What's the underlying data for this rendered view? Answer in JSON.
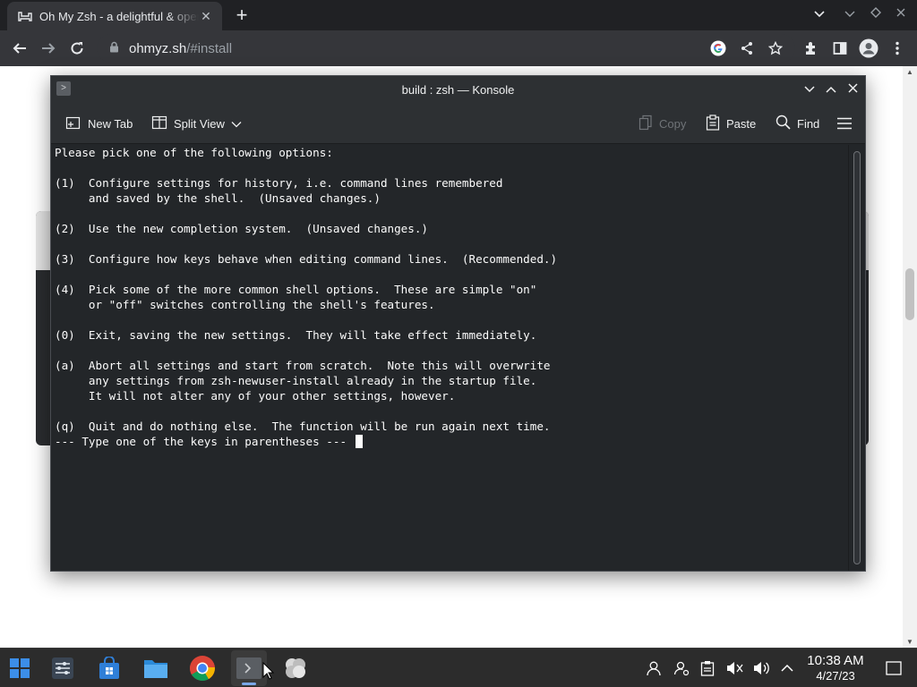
{
  "browser": {
    "tab_title": "Oh My Zsh - a delightful & open source framework for Zsh",
    "url_host": "ohmyz.sh",
    "url_path": "/#install",
    "icons": [
      "tab-favicon",
      "back-icon",
      "forward-icon",
      "reload-icon",
      "lock-icon",
      "google-icon",
      "share-icon",
      "star-icon",
      "extensions-icon",
      "sidepanel-icon",
      "profile-icon",
      "menu-icon"
    ]
  },
  "konsole": {
    "window_title": "build : zsh — Konsole",
    "toolbar": {
      "new_tab": "New Tab",
      "split_view": "Split View",
      "copy": "Copy",
      "paste": "Paste",
      "find": "Find"
    },
    "terminal_lines": [
      "Please pick one of the following options:",
      "",
      "(1)  Configure settings for history, i.e. command lines remembered",
      "     and saved by the shell.  (Unsaved changes.)",
      "",
      "(2)  Use the new completion system.  (Unsaved changes.)",
      "",
      "(3)  Configure how keys behave when editing command lines.  (Recommended.)",
      "",
      "(4)  Pick some of the more common shell options.  These are simple \"on\"",
      "     or \"off\" switches controlling the shell's features.",
      "",
      "(0)  Exit, saving the new settings.  They will take effect immediately.",
      "",
      "(a)  Abort all settings and start from scratch.  Note this will overwrite",
      "     any settings from zsh-newuser-install already in the startup file.",
      "     It will not alter any of your other settings, however.",
      "",
      "(q)  Quit and do nothing else.  The function will be run again next time.",
      "--- Type one of the keys in parentheses --- "
    ]
  },
  "taskbar": {
    "time": "10:38 AM",
    "date": "4/27/23",
    "apps": [
      "start-icon",
      "settings-app-icon",
      "store-app-icon",
      "files-app-icon",
      "chrome-app-icon",
      "terminal-app-icon",
      "gallery-app-icon"
    ],
    "tray": [
      "user-icon",
      "accounts-icon",
      "clipboard-icon",
      "mute-icon",
      "volume-icon",
      "chevron-up-icon",
      "notifications-icon"
    ]
  },
  "colors": {
    "terminal_bg": "#232629",
    "terminal_fg": "#fcfcfc",
    "chrome_bg": "#202124",
    "taskbar_bg": "#2c2c2c"
  }
}
